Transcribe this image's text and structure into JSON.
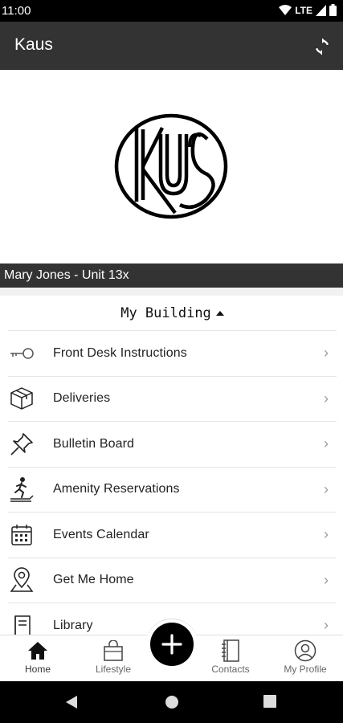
{
  "status_bar": {
    "time": "11:00",
    "network": "LTE"
  },
  "app_bar": {
    "title": "Kaus"
  },
  "user_bar": {
    "label": "Mary Jones - Unit 13x"
  },
  "section": {
    "title": "My Building"
  },
  "menu": [
    {
      "label": "Front Desk Instructions",
      "icon": "key-icon"
    },
    {
      "label": "Deliveries",
      "icon": "package-icon"
    },
    {
      "label": "Bulletin Board",
      "icon": "pushpin-icon"
    },
    {
      "label": "Amenity Reservations",
      "icon": "treadmill-icon"
    },
    {
      "label": "Events Calendar",
      "icon": "calendar-icon"
    },
    {
      "label": "Get Me Home",
      "icon": "map-pin-icon"
    },
    {
      "label": "Library",
      "icon": "book-icon"
    }
  ],
  "bottom_nav": {
    "home": "Home",
    "lifestyle": "Lifestyle",
    "contacts": "Contacts",
    "profile": "My Profile"
  }
}
